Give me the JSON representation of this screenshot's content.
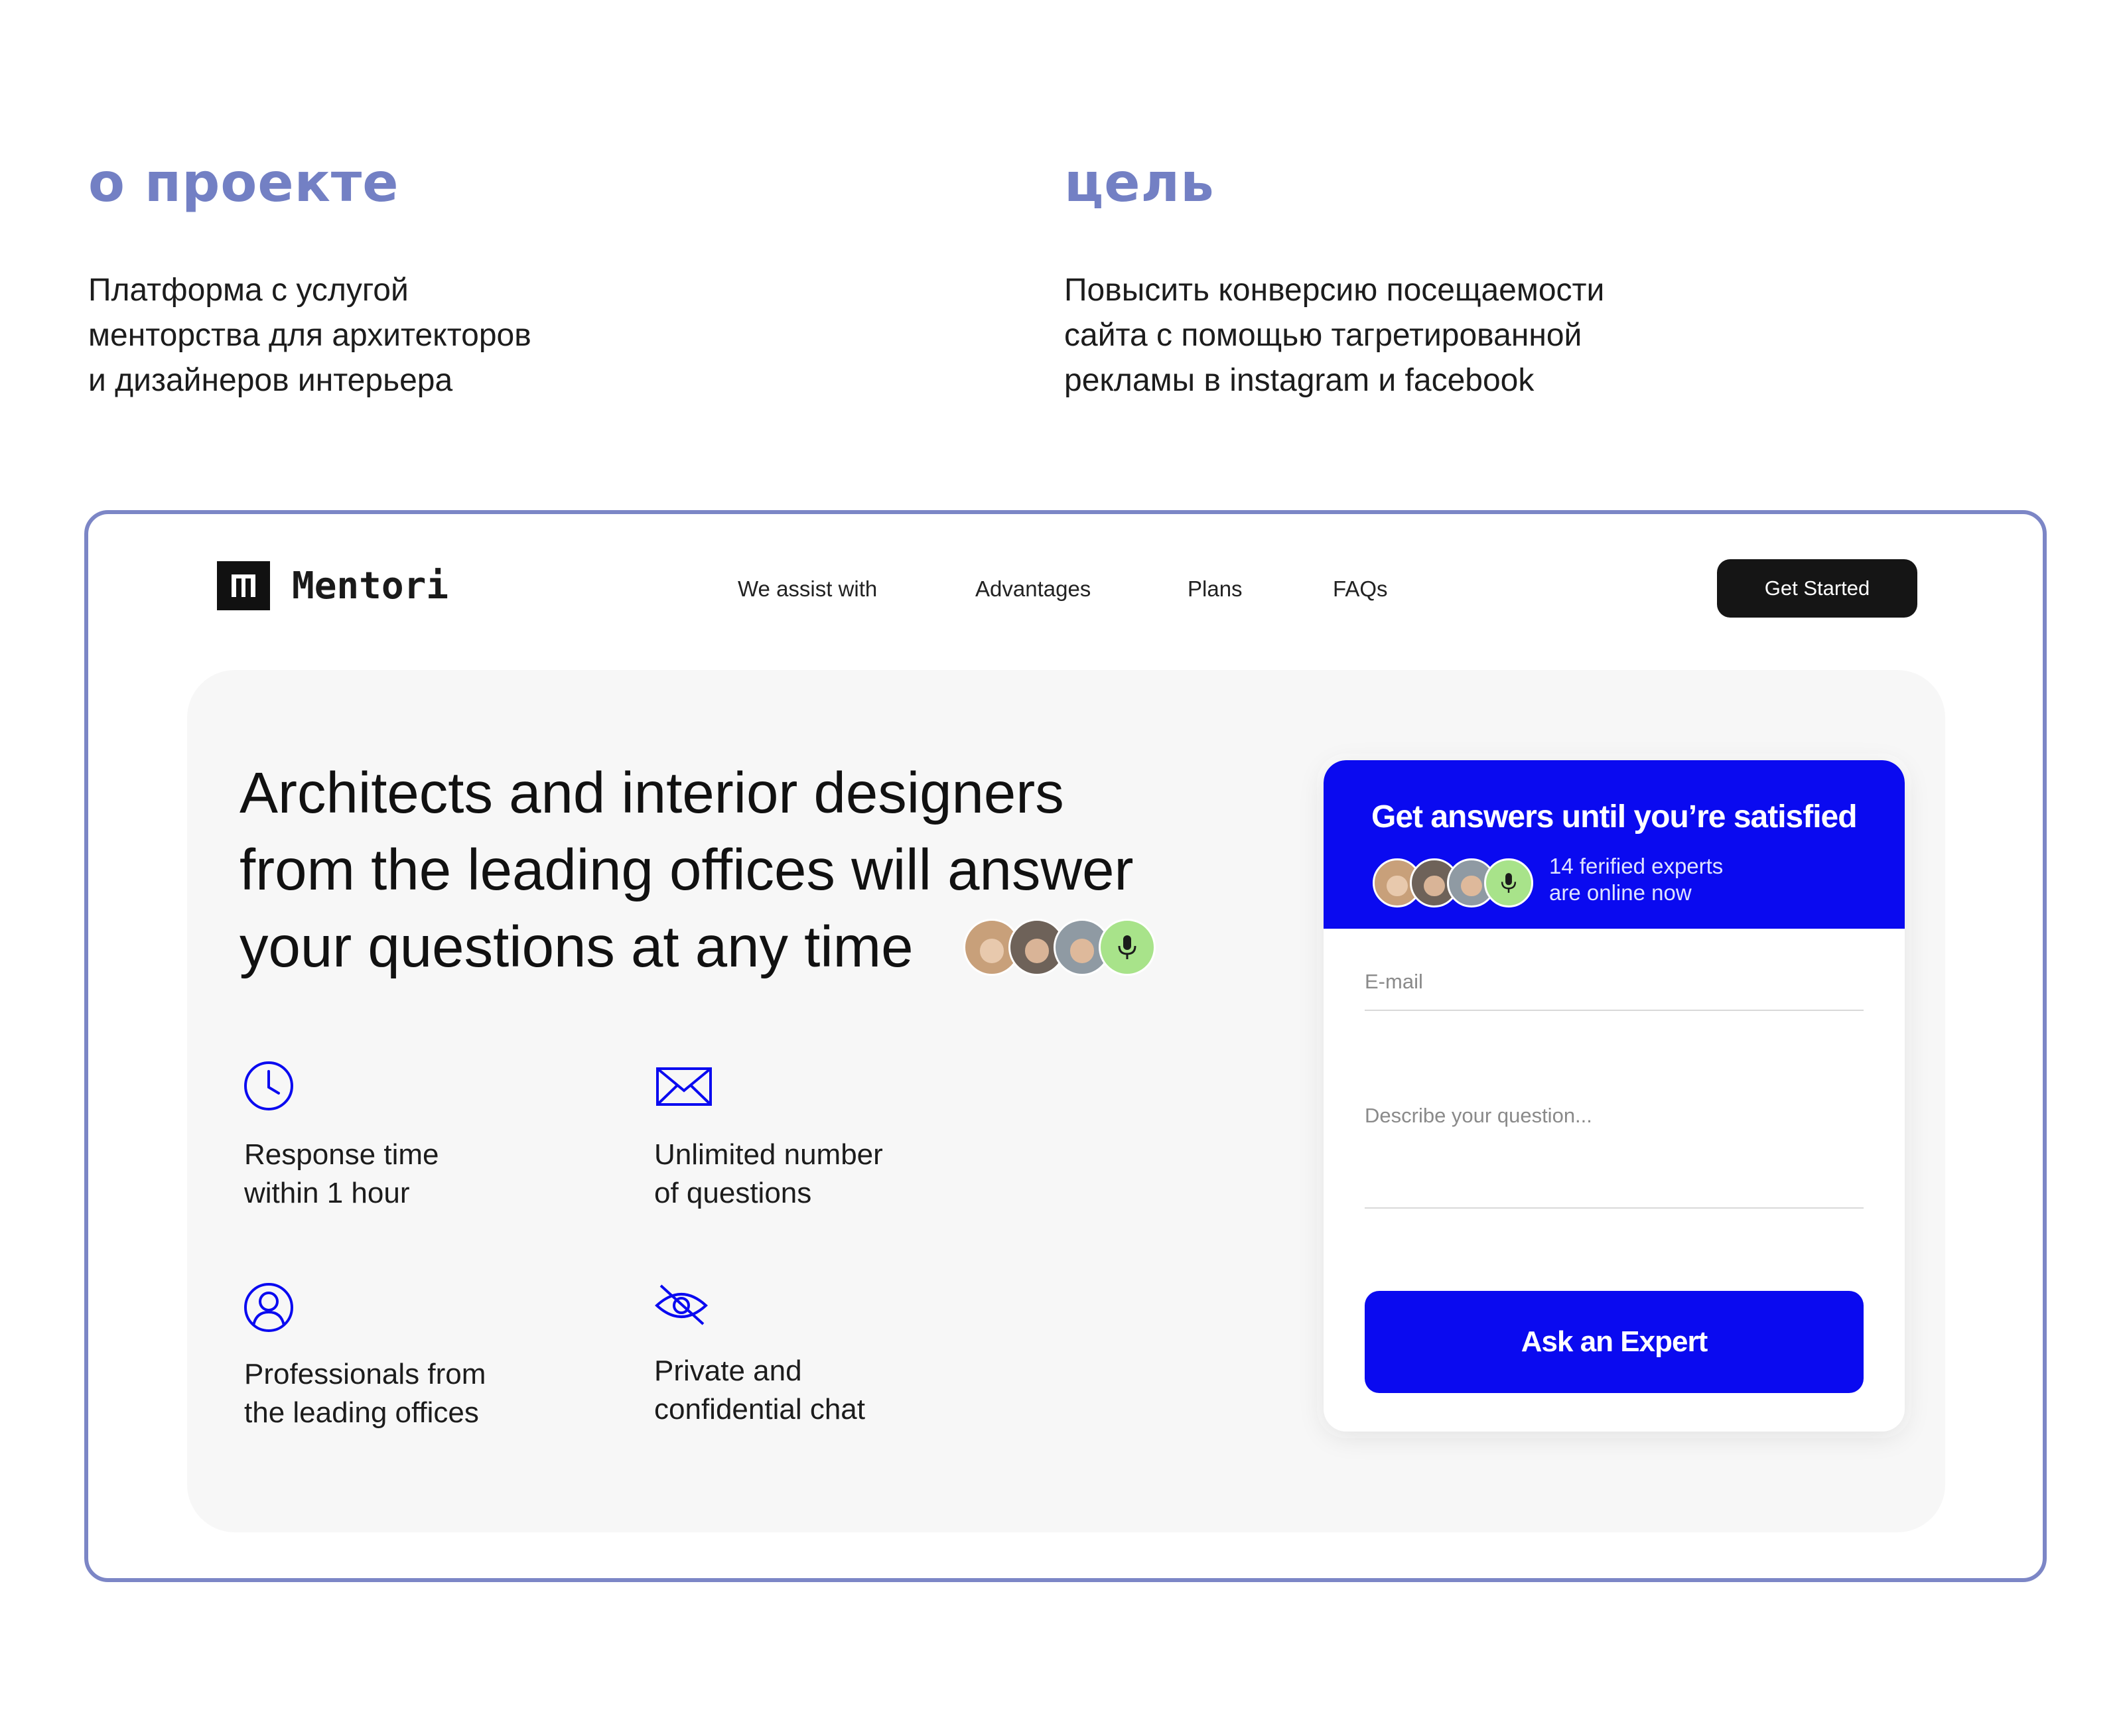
{
  "intro": {
    "about_title": "о проекте",
    "about_text": "Платформа с услугой\nменторства для архитекторов\nи дизайнеров интерьера",
    "goal_title": "цель",
    "goal_text": "Повысить конверсию посещаемости\nсайта с помощью тагретированной\nрекламы в instagram и facebook"
  },
  "header": {
    "logo_text": "Mentori",
    "nav": [
      "We assist with",
      "Advantages",
      "Plans",
      "FAQs"
    ],
    "cta": "Get Started"
  },
  "hero": {
    "heading_lines": [
      "Architects and interior designers",
      "from the leading offices will answer",
      "your questions at any time"
    ],
    "features": [
      {
        "icon": "clock-icon",
        "text": "Response time\nwithin 1 hour"
      },
      {
        "icon": "envelope-icon",
        "text": "Unlimited number\nof questions"
      },
      {
        "icon": "person-icon",
        "text": "Professionals from\nthe leading offices"
      },
      {
        "icon": "eye-off-icon",
        "text": "Private and\nconfidential chat"
      }
    ]
  },
  "card": {
    "title": "Get answers until you’re satisfied",
    "subtitle": "14 ferified experts\nare online now",
    "email_placeholder": "E-mail",
    "question_placeholder": "Describe your question...",
    "button": "Ask an Expert"
  },
  "colors": {
    "accent_blue": "#0a0af0",
    "frame_lavender": "#7c86c6",
    "title_lavender": "#7380c4",
    "mic_green": "#a8e38a"
  },
  "avatar_colors": [
    "#c8a07a",
    "#6e6259",
    "#8f9aa3"
  ]
}
